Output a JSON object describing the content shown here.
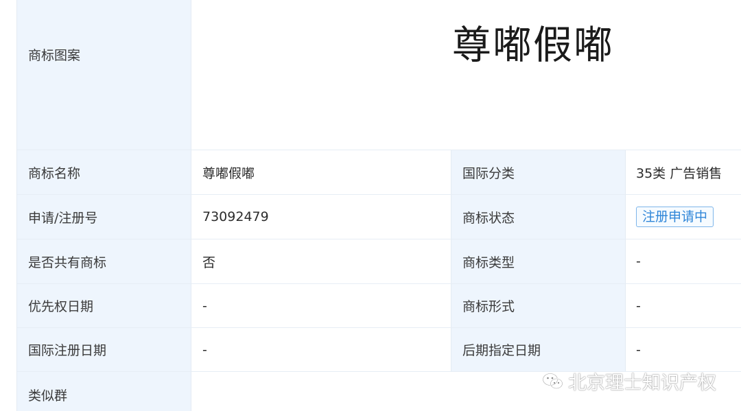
{
  "trademark_image": {
    "label": "商标图案",
    "image_text": "尊嘟假嘟"
  },
  "rows": [
    {
      "label_left": "商标名称",
      "value_left": "尊嘟假嘟",
      "label_right": "国际分类",
      "value_right": "35类 广告销售"
    },
    {
      "label_left": "申请/注册号",
      "value_left": "73092479",
      "label_right": "商标状态",
      "value_right": "注册申请中"
    },
    {
      "label_left": "是否共有商标",
      "value_left": "否",
      "label_right": "商标类型",
      "value_right": "-"
    },
    {
      "label_left": "优先权日期",
      "value_left": "-",
      "label_right": "商标形式",
      "value_right": "-"
    },
    {
      "label_left": "国际注册日期",
      "value_left": "-",
      "label_right": "后期指定日期",
      "value_right": "-"
    }
  ],
  "similar_group": {
    "label": "类似群"
  },
  "watermark": {
    "text": "北京理士知识产权",
    "icon": "wechat-icon"
  },
  "colors": {
    "label_background": "#eef5fd",
    "status_accent": "#2f86d8",
    "border": "#e3ebf3"
  }
}
